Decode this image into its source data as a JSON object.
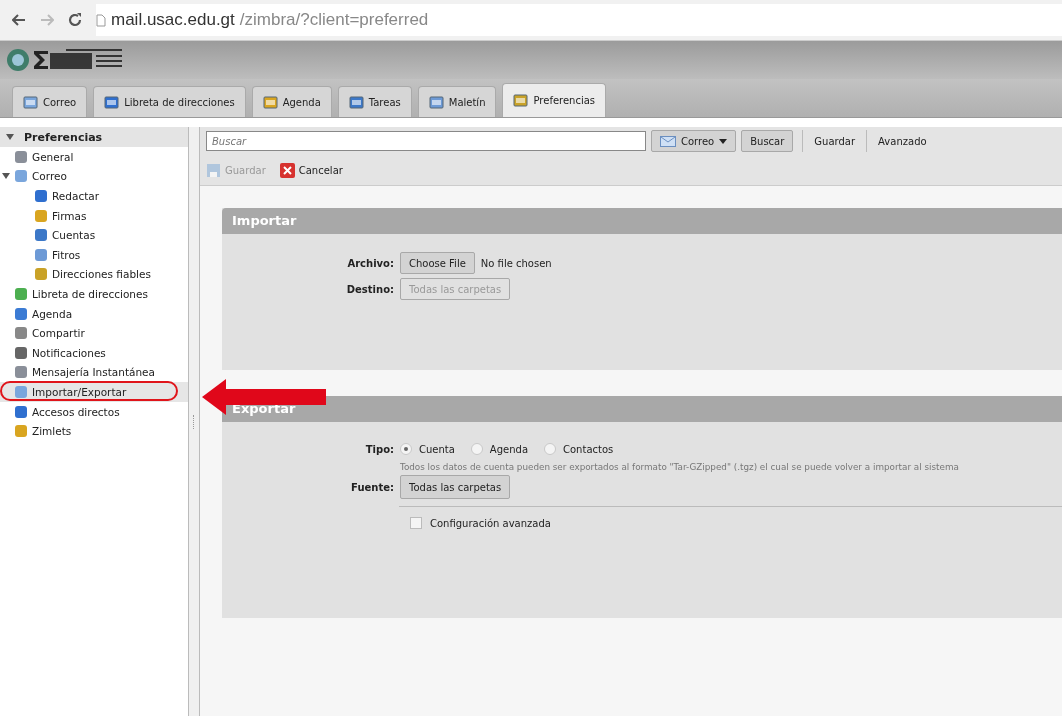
{
  "browser": {
    "url_host": "mail.usac.edu.gt",
    "url_path": "/zimbra/?client=preferred"
  },
  "tabs": [
    {
      "label": "Correo",
      "selected": false
    },
    {
      "label": "Libreta de direcciones",
      "selected": false
    },
    {
      "label": "Agenda",
      "selected": false
    },
    {
      "label": "Tareas",
      "selected": false
    },
    {
      "label": "Maletín",
      "selected": false
    },
    {
      "label": "Preferencias",
      "selected": true
    }
  ],
  "sidebar": {
    "title": "Preferencias",
    "expanded": true,
    "items": [
      {
        "label": "General",
        "selected": false
      },
      {
        "label": "Correo",
        "selected": false,
        "expanded": true,
        "children": [
          {
            "label": "Redactar",
            "selected": false
          },
          {
            "label": "Firmas",
            "selected": false
          },
          {
            "label": "Cuentas",
            "selected": false
          },
          {
            "label": "Fitros",
            "selected": false
          },
          {
            "label": "Direcciones fiables",
            "selected": false
          }
        ]
      },
      {
        "label": "Libreta de direcciones",
        "selected": false
      },
      {
        "label": "Agenda",
        "selected": false
      },
      {
        "label": "Compartir",
        "selected": false
      },
      {
        "label": "Notificaciones",
        "selected": false
      },
      {
        "label": "Mensajería Instantánea",
        "selected": false
      },
      {
        "label": "Importar/Exportar",
        "selected": true
      },
      {
        "label": "Accesos directos",
        "selected": false
      },
      {
        "label": "Zimlets",
        "selected": false
      }
    ]
  },
  "search": {
    "placeholder": "Buscar",
    "scope": "Correo",
    "button": "Buscar",
    "save": "Guardar",
    "advanced": "Avanzado"
  },
  "toolbar": [
    {
      "label": "Guardar",
      "disabled": true
    },
    {
      "label": "Cancelar",
      "disabled": false
    }
  ],
  "import": {
    "title": "Importar",
    "file_label": "Archivo:",
    "file_button": "Choose File",
    "file_status": "No file chosen",
    "dest_label": "Destino:",
    "dest_value": "Todas las carpetas"
  },
  "export": {
    "title": "Exportar",
    "type_label": "Tipo:",
    "types": [
      {
        "label": "Cuenta",
        "selected": true
      },
      {
        "label": "Agenda",
        "selected": false
      },
      {
        "label": "Contactos",
        "selected": false
      }
    ],
    "description": "Todos los datos de cuenta pueden ser exportados al formato \"Tar-GZipped\" (.tgz) el cual se puede volver a importar al sistema",
    "source_label": "Fuente:",
    "source_value": "Todas las carpetas",
    "advanced": {
      "label": "Configuración avanzada",
      "checked": false
    }
  }
}
